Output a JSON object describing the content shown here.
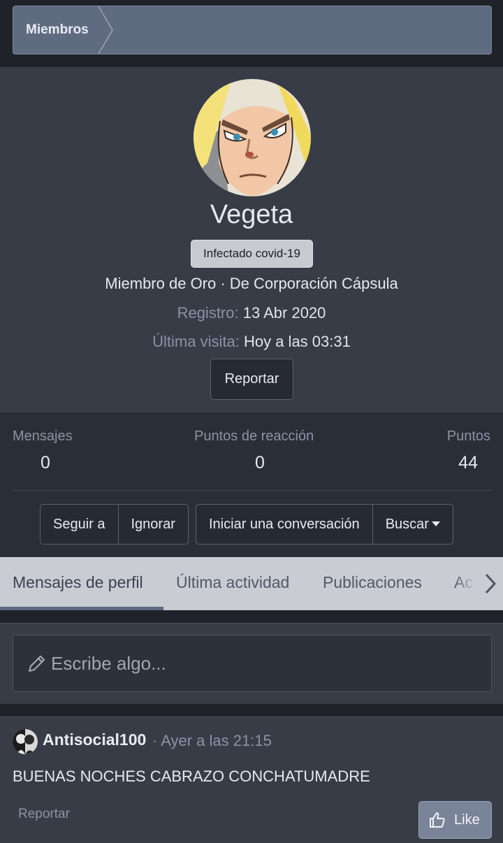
{
  "breadcrumb": {
    "label": "Miembros"
  },
  "profile": {
    "username": "Vegeta",
    "badge": "Infectado covid-19",
    "title_line": "Miembro de Oro · De Corporación Cápsula",
    "registered_label": "Registro:",
    "registered_value": "13 Abr 2020",
    "last_seen_label": "Última visita:",
    "last_seen_value": "Hoy a las 03:31",
    "report_label": "Reportar"
  },
  "stats": {
    "messages_label": "Mensajes",
    "messages_value": "0",
    "reactions_label": "Puntos de reacción",
    "reactions_value": "0",
    "points_label": "Puntos",
    "points_value": "44"
  },
  "actions": {
    "follow": "Seguir a",
    "ignore": "Ignorar",
    "conversation": "Iniciar una conversación",
    "search": "Buscar"
  },
  "tabs": [
    {
      "label": "Mensajes de perfil",
      "active": true
    },
    {
      "label": "Última actividad"
    },
    {
      "label": "Publicaciones"
    },
    {
      "label": "Ac"
    }
  ],
  "composer": {
    "placeholder": "Escribe algo..."
  },
  "post": {
    "author": "Antisocial100",
    "time": "· Ayer a las 21:15",
    "body": "BUENAS NOCHES CABRAZO CONCHATUMADRE",
    "report": "Reportar",
    "like": "Like"
  },
  "colors": {
    "background": "#1f2229",
    "panel": "#373c47",
    "breadcrumb": "#5f6b80",
    "tab_bar": "#c9ccd2",
    "like_button": "#7a8498"
  },
  "icons": [
    "chevron-right-icon",
    "pencil-icon",
    "thumbs-up-icon",
    "caret-down-icon"
  ]
}
